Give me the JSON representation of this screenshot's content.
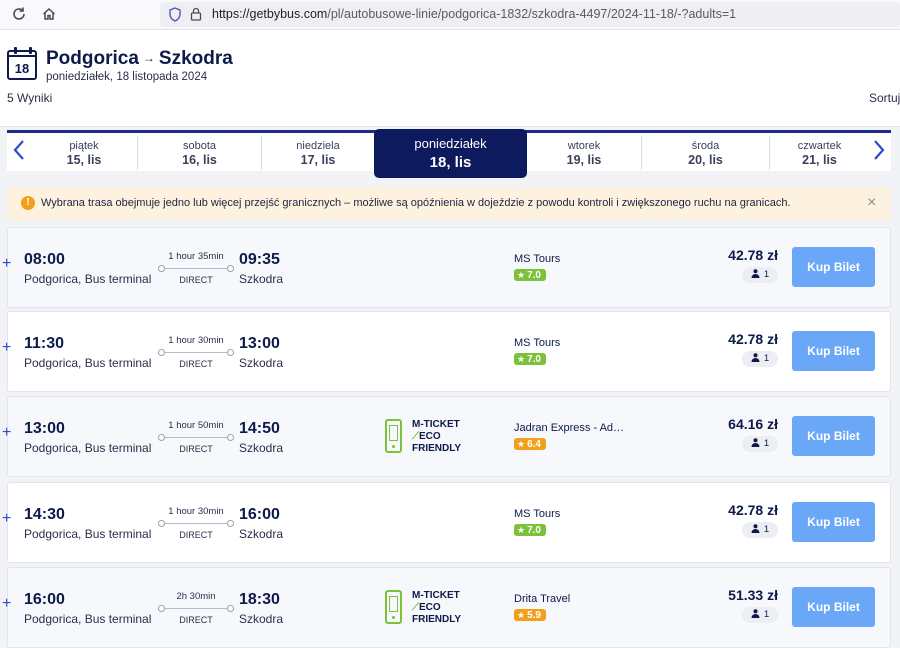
{
  "browser": {
    "reload_icon": "reload-icon",
    "home_icon": "home-icon",
    "url_host": "https://getbybus.com",
    "url_path": "/pl/autobusowe-linie/podgorica-1832/szkodra-4497/2024-11-18/-?adults=1"
  },
  "header": {
    "calendar_day": "18",
    "from": "Podgorica",
    "arrow": "→",
    "to": "Szkodra",
    "date": "poniedziałek, 18 listopada 2024",
    "results": "5 Wyniki",
    "sort": "Sortuj"
  },
  "dates": [
    {
      "name": "piątek",
      "date": "15, lis"
    },
    {
      "name": "sobota",
      "date": "16, lis"
    },
    {
      "name": "niedziela",
      "date": "17, lis"
    },
    {
      "name": "poniedziałek",
      "date": "18, lis",
      "active": true
    },
    {
      "name": "wtorek",
      "date": "19, lis"
    },
    {
      "name": "środa",
      "date": "20, lis"
    },
    {
      "name": "czwartek",
      "date": "21, lis"
    }
  ],
  "warning": {
    "icon": "!",
    "text": "Wybrana trasa obejmuje jedno lub więcej przejść granicznych – możliwe są opóźnienia w dojeździe z powodu kontroli i zwiększonego ruchu na granicach.",
    "close": "×"
  },
  "labels": {
    "direct": "DIRECT",
    "buy": "Kup Bilet",
    "expand": "+",
    "mticket_line1": "M-TICKET",
    "mticket_line2": "ECO",
    "mticket_line3": "FRIENDLY",
    "passenger_icon": "person-icon"
  },
  "trips": [
    {
      "dep_time": "08:00",
      "dep_station": "Podgorica, Bus terminal",
      "duration": "1 hour 35min",
      "arr_time": "09:35",
      "arr_station": "Szkodra",
      "mticket": false,
      "operator": "MS Tours",
      "rating": "7.0",
      "rating_color": "#7cc13a",
      "price": "42.78 zł",
      "passengers": "1"
    },
    {
      "dep_time": "11:30",
      "dep_station": "Podgorica, Bus terminal",
      "duration": "1 hour 30min",
      "arr_time": "13:00",
      "arr_station": "Szkodra",
      "mticket": false,
      "operator": "MS Tours",
      "rating": "7.0",
      "rating_color": "#7cc13a",
      "price": "42.78 zł",
      "passengers": "1"
    },
    {
      "dep_time": "13:00",
      "dep_station": "Podgorica, Bus terminal",
      "duration": "1 hour 50min",
      "arr_time": "14:50",
      "arr_station": "Szkodra",
      "mticket": true,
      "operator": "Jadran Express - Ad…",
      "rating": "6.4",
      "rating_color": "#f2a01b",
      "price": "64.16 zł",
      "passengers": "1"
    },
    {
      "dep_time": "14:30",
      "dep_station": "Podgorica, Bus terminal",
      "duration": "1 hour 30min",
      "arr_time": "16:00",
      "arr_station": "Szkodra",
      "mticket": false,
      "operator": "MS Tours",
      "rating": "7.0",
      "rating_color": "#7cc13a",
      "price": "42.78 zł",
      "passengers": "1"
    },
    {
      "dep_time": "16:00",
      "dep_station": "Podgorica, Bus terminal",
      "duration": "2h 30min",
      "arr_time": "18:30",
      "arr_station": "Szkodra",
      "mticket": true,
      "operator": "Drita Travel",
      "rating": "5.9",
      "rating_color": "#f2a01b",
      "price": "51.33 zł",
      "passengers": "1"
    }
  ]
}
